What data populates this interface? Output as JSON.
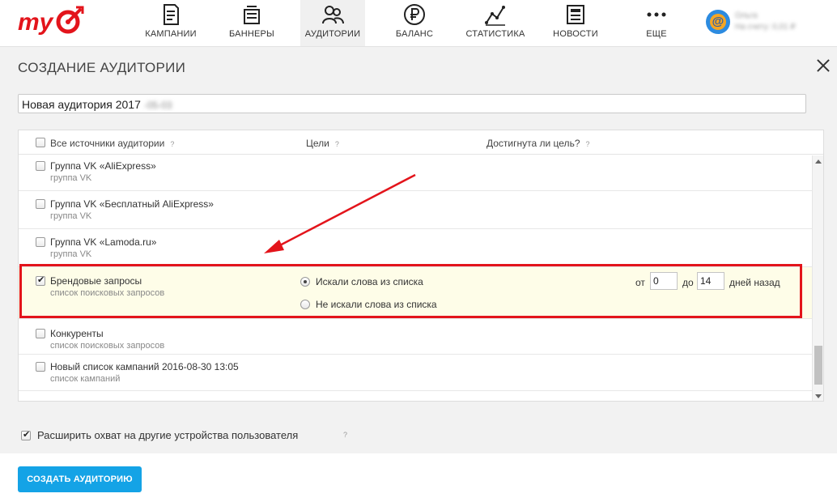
{
  "brand": {
    "accent_red": "#e3141b",
    "accent_blue": "#14a3e6",
    "panel_bg": "#f2f2f2",
    "highlight_bg": "#fefde8",
    "logo_icon": "mytarget-logo"
  },
  "nav": {
    "items": [
      {
        "label": "КАМПАНИИ",
        "icon": "campaigns-icon"
      },
      {
        "label": "БАННЕРЫ",
        "icon": "banners-icon"
      },
      {
        "label": "АУДИТОРИИ",
        "icon": "audiences-icon",
        "active": true
      },
      {
        "label": "БАЛАНС",
        "icon": "ruble-icon"
      },
      {
        "label": "СТАТИСТИКА",
        "icon": "statistics-icon"
      },
      {
        "label": "НОВОСТИ",
        "icon": "news-icon"
      },
      {
        "label": "ЕЩЕ",
        "icon": "more-icon"
      }
    ],
    "account": {
      "icon": "mail-icon",
      "name": "Ольга",
      "balance": "На счету: 0,01 ₽"
    }
  },
  "page": {
    "title": "СОЗДАНИЕ АУДИТОРИИ",
    "audience_name": "Новая аудитория 2017",
    "audience_name_suffix": "-05-03"
  },
  "table": {
    "headers": {
      "sources": "Все источники аудитории",
      "goals": "Цели",
      "goal_reached": "Достигнута ли цель?",
      "help": "?"
    },
    "rows": [
      {
        "title": "Группа VK «AliExpress»",
        "subtitle": "группа VK",
        "checked": false
      },
      {
        "title": "Группа VK «Бесплатный AliExpress»",
        "subtitle": "группа VK",
        "checked": false
      },
      {
        "title": "Группа VK «Lamoda.ru»",
        "subtitle": "группа VK",
        "checked": false
      },
      {
        "title": "Брендовые запросы",
        "subtitle": "список поисковых запросов",
        "checked": true,
        "options": {
          "searched": "Искали слова из списка",
          "not_searched": "Не искали слова из списка",
          "selected": "searched"
        },
        "period": {
          "from_label": "от",
          "from": "0",
          "to_label": "до",
          "to": "14",
          "suffix": "дней назад"
        }
      },
      {
        "title": "Конкуренты",
        "subtitle": "список поисковых запросов",
        "checked": false
      },
      {
        "title": "Новый список кампаний 2016-08-30 13:05",
        "subtitle": "список кампаний",
        "checked": false
      }
    ]
  },
  "footer": {
    "expand_label": "Расширить охват на другие устройства пользователя",
    "expand_checked": true,
    "help": "?",
    "create_button": "СОЗДАТЬ АУДИТОРИЮ"
  }
}
